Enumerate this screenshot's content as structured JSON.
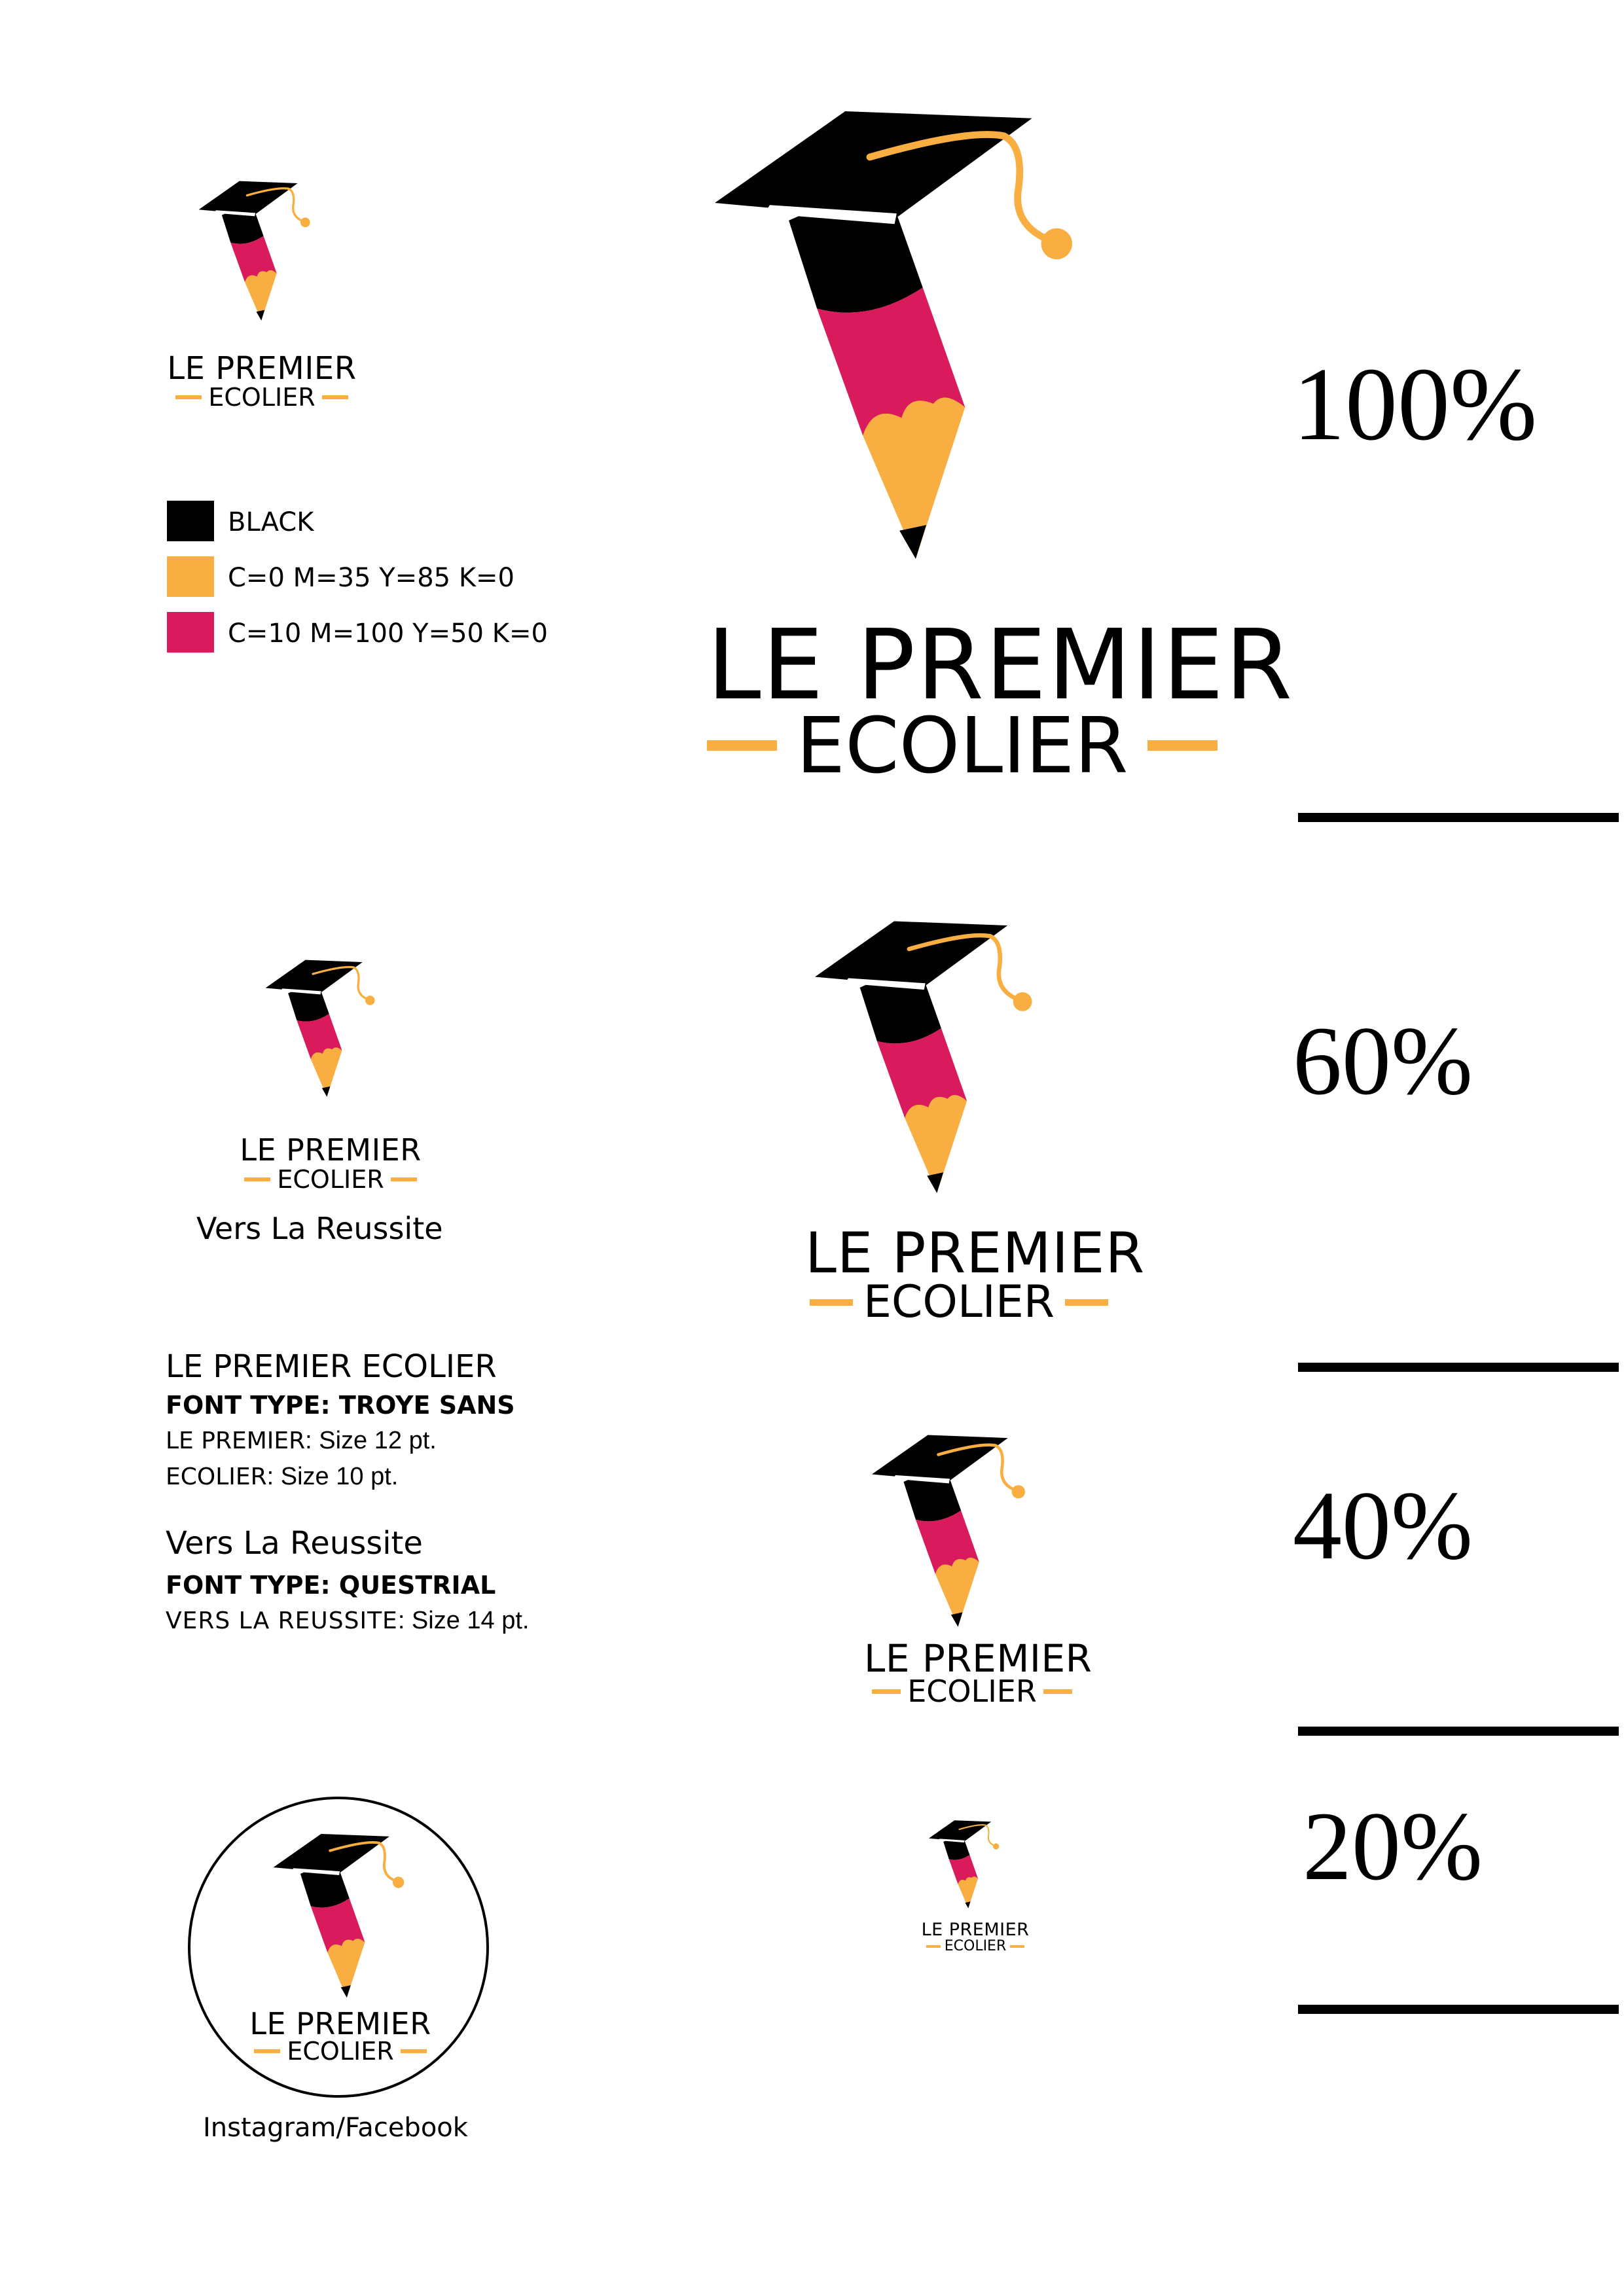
{
  "brand": {
    "line1": "LE PREMIER",
    "line2": "ECOLIER",
    "tagline": "Vers La Reussite"
  },
  "colors": {
    "black": "#000000",
    "orange": "#F9AE41",
    "pink": "#D91A5D"
  },
  "icons": {
    "logo": "graduation-cap-pencil-icon"
  },
  "swatches": [
    {
      "label": "BLACK",
      "color": "#000000"
    },
    {
      "label": "C=0 M=35 Y=85 K=0",
      "color": "#F9AE41"
    },
    {
      "label": "C=10 M=100 Y=50 K=0",
      "color": "#D91A5D"
    }
  ],
  "scales": [
    {
      "label": "100%"
    },
    {
      "label": "60%"
    },
    {
      "label": "40%"
    },
    {
      "label": "20%"
    }
  ],
  "typography": {
    "name_heading": "LE PREMIER ECOLIER",
    "name_font": "FONT TYPE:  TROYE SANS",
    "line1_key": "LE PREMIER",
    "line1_val": ": Size 12 pt.",
    "line2_key": "ECOLIER",
    "line2_val": ": Size 10 pt.",
    "tag_heading": "Vers La Reussite",
    "tag_font": "FONT TYPE:  QUESTRIAL",
    "tag_key": "VERS LA REUSSITE",
    "tag_val": ": Size 14 pt."
  },
  "social_label": "Instagram/Facebook"
}
